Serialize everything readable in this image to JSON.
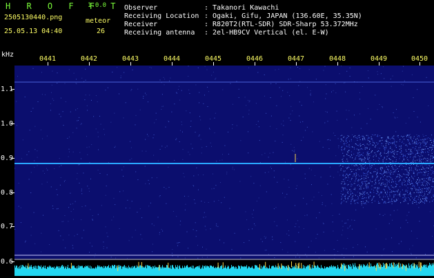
{
  "app": {
    "logo": "H R O F F T",
    "version": "1.0.0"
  },
  "capture": {
    "filename": "2505130440.png",
    "meteor_label": "meteor",
    "datetime": "25.05.13 04:40",
    "meteor_count": "26"
  },
  "info": [
    {
      "key": "Observer",
      "value": ": Takanori Kawachi"
    },
    {
      "key": "Receiving Location",
      "value": ": Ogaki, Gifu, JAPAN (136.60E, 35.35N)"
    },
    {
      "key": "Receiver",
      "value": ": R820T2(RTL-SDR) SDR-Sharp 53.372MHz"
    },
    {
      "key": "Receiving antenna",
      "value": ": 2el-HB9CV Vertical (el. E-W)"
    }
  ],
  "axes": {
    "y_unit": "kHz",
    "y_ticks": [
      "1.1",
      "1.0",
      "0.9",
      "0.8",
      "0.7",
      "0.6"
    ],
    "x_ticks": [
      "0441",
      "0442",
      "0443",
      "0444",
      "0445",
      "0446",
      "0447",
      "0448",
      "0449",
      "0450"
    ]
  },
  "colors": {
    "background": "#000000",
    "waterfall": "#0b0e6e",
    "carrier": "#2aa8ff",
    "spectrum": "#24d7f0",
    "meteor_echo": "#ffd84a",
    "labels_yellow": "#ffff66",
    "labels_green": "#7cff3a"
  }
}
